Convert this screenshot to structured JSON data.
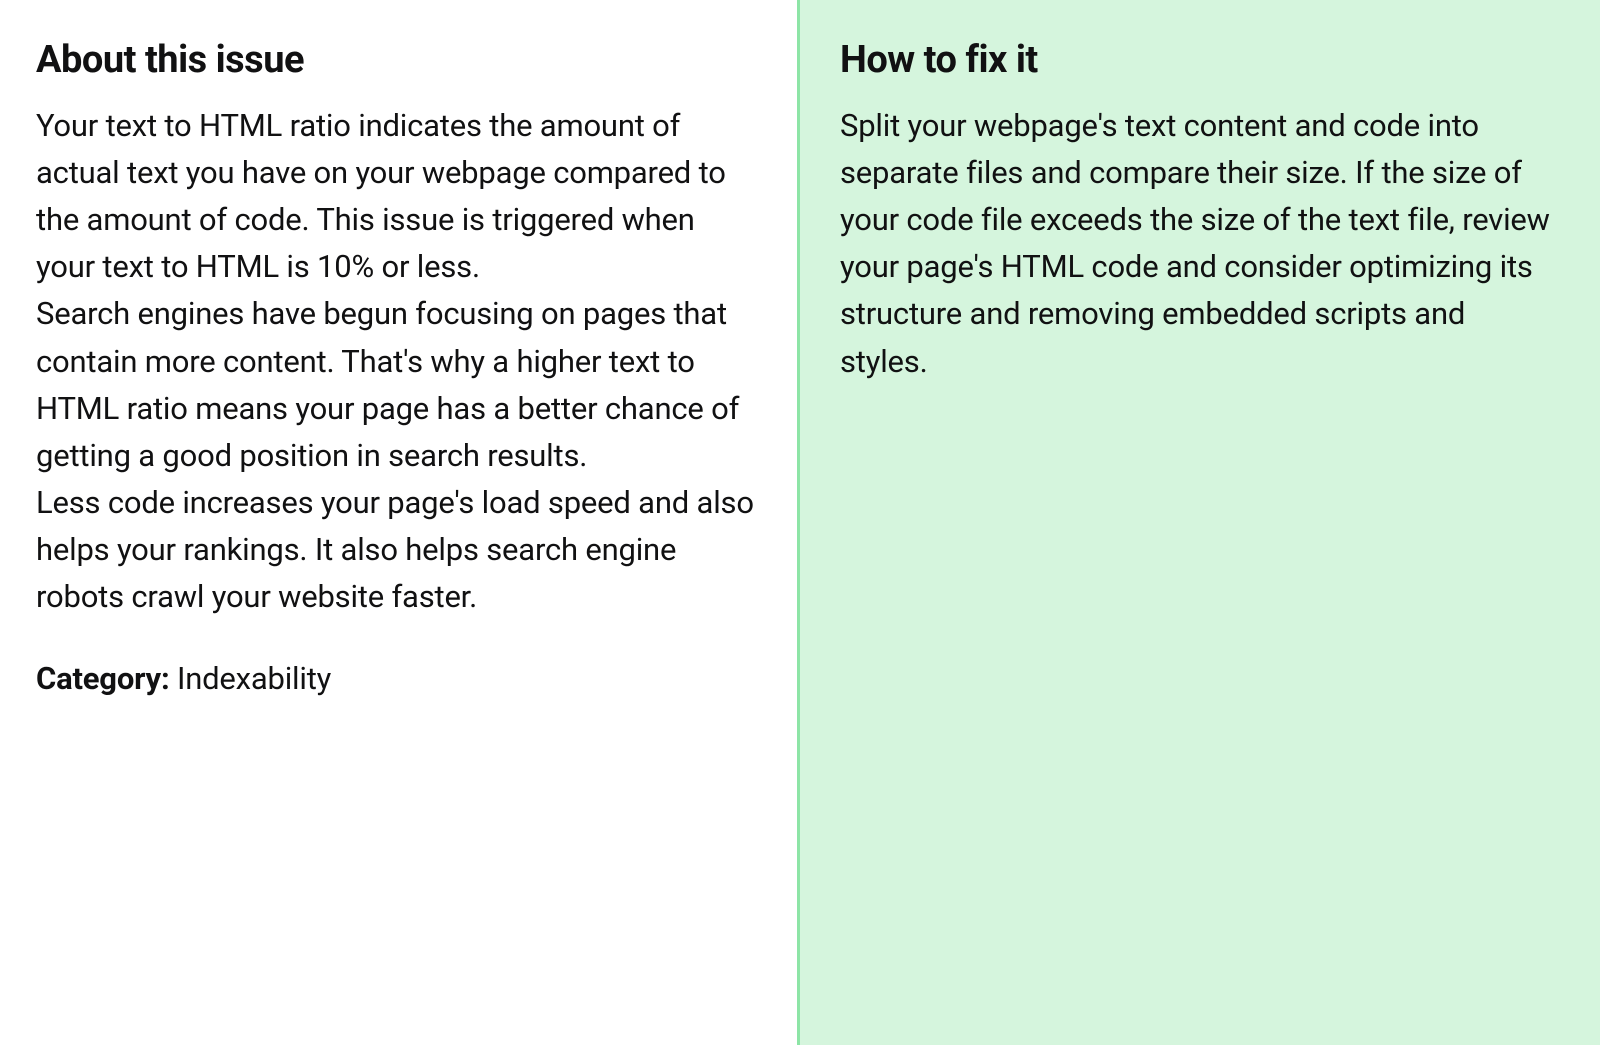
{
  "left": {
    "heading": "About this issue",
    "para1": "Your text to HTML ratio indicates the amount of actual text you have on your webpage compared to the amount of code. This issue is triggered when your text to HTML is 10% or less.",
    "para2": "Search engines have begun focusing on pages that contain more content. That's why a higher text to HTML ratio means your page has a better chance of getting a good position in search results.",
    "para3": "Less code increases your page's load speed and also helps your rankings. It also helps search engine robots crawl your website faster.",
    "category_label": "Category: ",
    "category_value": "Indexability"
  },
  "right": {
    "heading": "How to fix it",
    "body": "Split your webpage's text content and code into separate files and compare their size. If the size of your code file exceeds the size of the text file, review your page's HTML code and consider optimizing its structure and removing embedded scripts and styles."
  }
}
